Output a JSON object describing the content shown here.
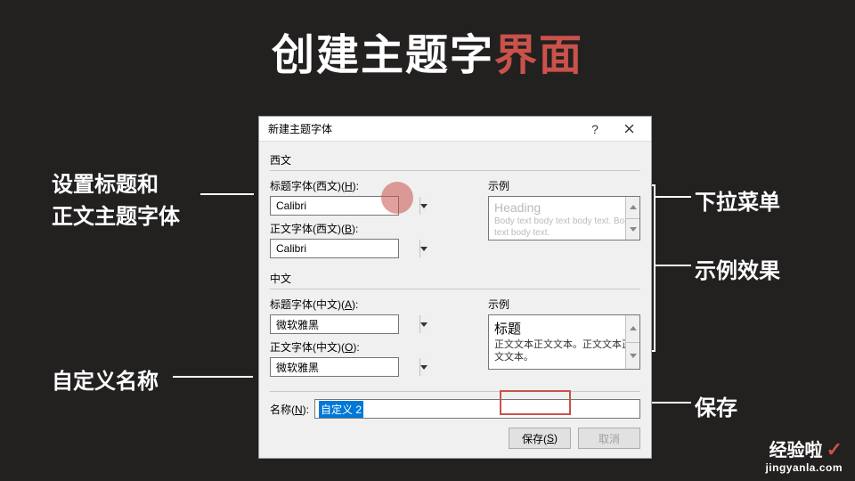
{
  "slide": {
    "title_a": "创建主题字",
    "title_b": "界面"
  },
  "annotations": {
    "left1a": "设置标题和",
    "left1b": "正文主题字体",
    "left2": "自定义名称",
    "right1": "下拉菜单",
    "right2": "示例效果",
    "right3": "保存"
  },
  "dialog": {
    "title": "新建主题字体",
    "help": "?",
    "section_latin": "西文",
    "section_cjk": "中文",
    "label_heading_latin": "标题字体(西文)(H):",
    "label_body_latin": "正文字体(西文)(B):",
    "label_heading_cjk": "标题字体(中文)(A):",
    "label_body_cjk": "正文字体(中文)(O):",
    "label_sample": "示例",
    "font_calibri": "Calibri",
    "font_msyh": "微软雅黑",
    "preview_latin_heading": "Heading",
    "preview_latin_body": "Body text body text body text. Body text body text.",
    "preview_cjk_heading": "标题",
    "preview_cjk_body": "正文文本正文文本。正文文本正文文本。",
    "name_label": "名称(N):",
    "name_value": "自定义 2",
    "btn_save": "保存(S)",
    "btn_cancel": "取消"
  },
  "watermark": {
    "line1": "经验啦",
    "line2": "jingyanla.com"
  }
}
